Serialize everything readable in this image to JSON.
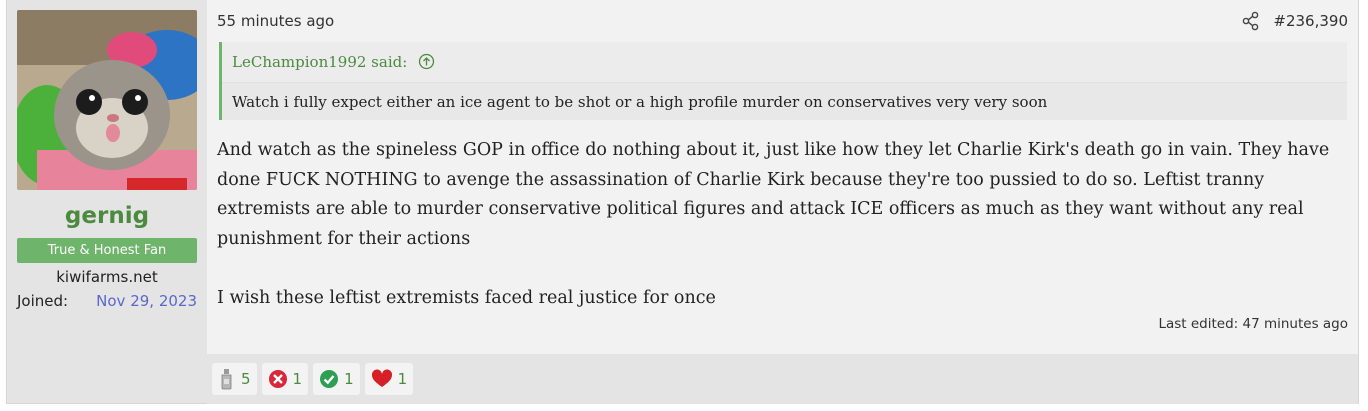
{
  "user": {
    "name": "gernig",
    "title": "True & Honest Fan",
    "site": "kiwifarms.net",
    "joined_label": "Joined:",
    "joined_date": "Nov 29, 2023"
  },
  "post": {
    "time": "55 minutes ago",
    "number": "#236,390",
    "quote": {
      "author": "LeChampion1992 said:",
      "text": "Watch i fully expect either an ice agent to be shot or a high profile murder on conservatives very very soon"
    },
    "paragraphs": [
      "And watch as the spineless GOP in office do nothing about it, just like how they let Charlie Kirk's death go in vain. They have done FUCK NOTHING to avenge the assassination of Charlie Kirk because they're too pussied to do so. Leftist tranny extremists are able to murder conservative political figures and attack ICE officers as much as they want without any real punishment for their actions",
      "I wish these leftist extremists faced real justice for once"
    ],
    "last_edited": "Last edited: 47 minutes ago"
  },
  "reactions": [
    {
      "icon": "bottle-icon",
      "count": "5"
    },
    {
      "icon": "red-x-icon",
      "count": "1"
    },
    {
      "icon": "green-check-icon",
      "count": "1"
    },
    {
      "icon": "heart-icon",
      "count": "1"
    }
  ],
  "colors": {
    "username": "#4c8a3f",
    "user_title_bg": "#6fb46b",
    "joined_date": "#5a68c8",
    "quote_border": "#6fb46b"
  }
}
